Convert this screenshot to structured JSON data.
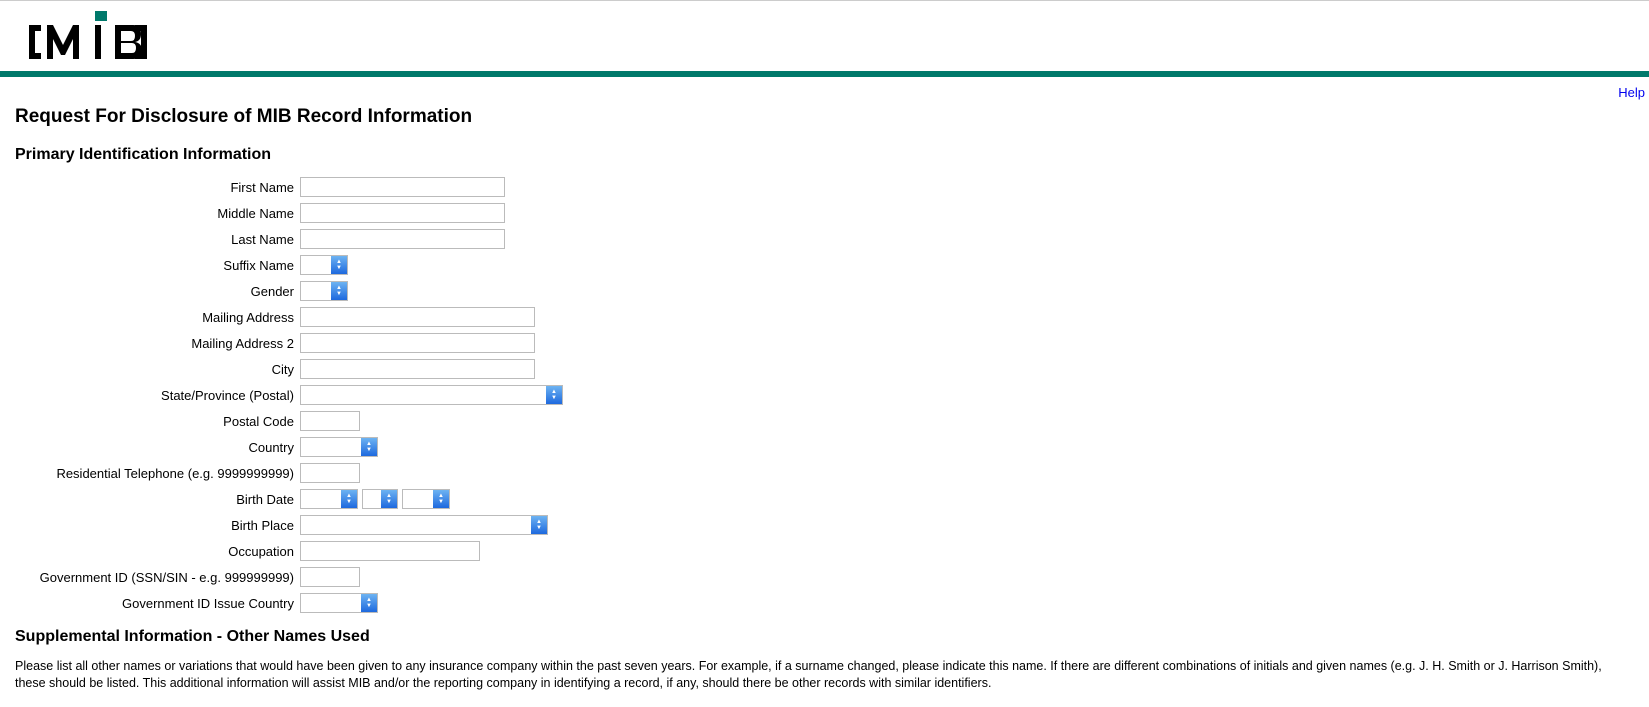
{
  "nav": {
    "help": "Help"
  },
  "page_title": "Request For Disclosure of MIB Record Information",
  "section1_title": "Primary Identification Information",
  "fields": {
    "first_name": "First Name",
    "middle_name": "Middle Name",
    "last_name": "Last Name",
    "suffix": "Suffix Name",
    "gender": "Gender",
    "mailing_address": "Mailing Address",
    "mailing_address2": "Mailing Address 2",
    "city": "City",
    "state": "State/Province (Postal)",
    "postal_code": "Postal Code",
    "country": "Country",
    "residential_phone": "Residential Telephone (e.g. 9999999999)",
    "birth_date": "Birth Date",
    "birth_place": "Birth Place",
    "occupation": "Occupation",
    "gov_id": "Government ID (SSN/SIN - e.g. 999999999)",
    "gov_id_country": "Government ID Issue Country"
  },
  "values": {
    "first_name": "",
    "middle_name": "",
    "last_name": "",
    "suffix": "",
    "gender": "",
    "mailing_address": "",
    "mailing_address2": "",
    "city": "",
    "state": "",
    "postal_code": "",
    "country": "",
    "residential_phone": "",
    "birth_month": "",
    "birth_day": "",
    "birth_year": "",
    "birth_place": "",
    "occupation": "",
    "gov_id": "",
    "gov_id_country": ""
  },
  "section2_title": "Supplemental Information - Other Names Used",
  "section2_text": "Please list all other names or variations that would have been given to any insurance company within the past seven years. For example, if a surname changed, please indicate this name. If there are different combinations of initials and given names (e.g. J. H. Smith or J. Harrison Smith), these should be listed. This additional information will assist MIB and/or the reporting company in identifying a record, if any, should there be other records with similar identifiers."
}
